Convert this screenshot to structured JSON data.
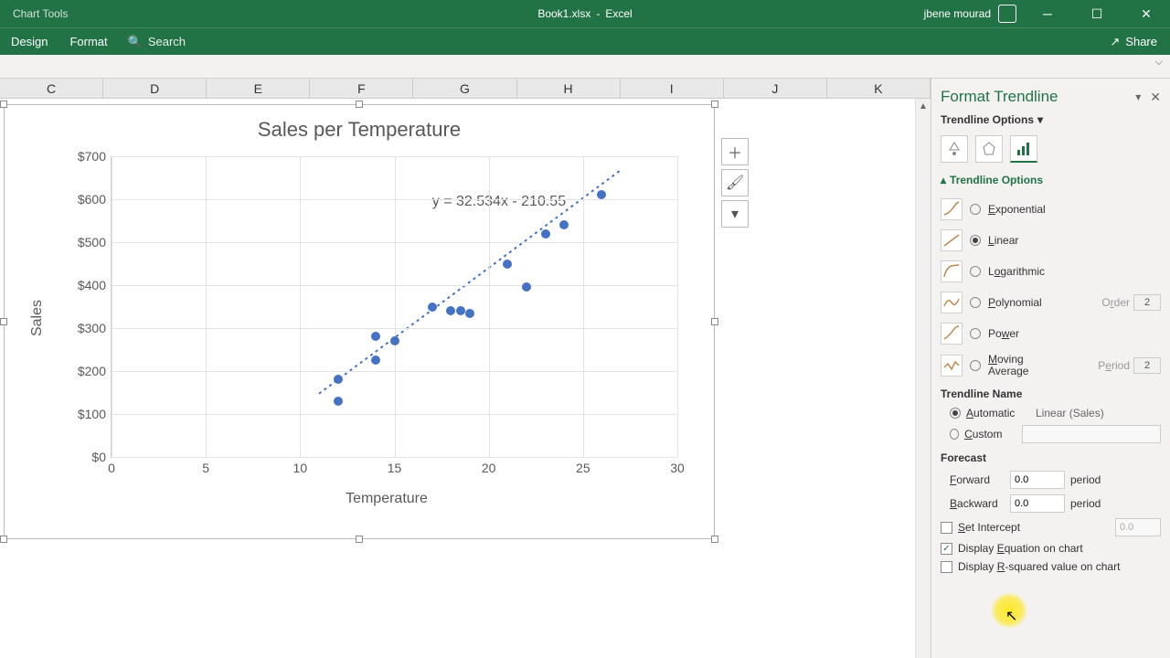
{
  "titlebar": {
    "chart_tools": "Chart Tools",
    "filename": "Book1.xlsx",
    "appname": "Excel",
    "user": "jbene mourad"
  },
  "tabs": {
    "design": "Design",
    "format": "Format",
    "search": "Search",
    "share": "Share"
  },
  "columns": [
    "C",
    "D",
    "E",
    "F",
    "G",
    "H",
    "I",
    "J",
    "K"
  ],
  "chart_title": "Sales per Temperature",
  "chart_ylabel": "Sales",
  "chart_xlabel": "Temperature",
  "chart_equation": "y = 32.534x - 210.55",
  "chart_data": {
    "type": "scatter",
    "title": "Sales per Temperature",
    "xlabel": "Temperature",
    "ylabel": "Sales",
    "xlim": [
      0,
      30
    ],
    "ylim": [
      0,
      700
    ],
    "xticks": [
      0,
      5,
      10,
      15,
      20,
      25,
      30
    ],
    "yticks": [
      0,
      100,
      200,
      300,
      400,
      500,
      600,
      700
    ],
    "ytick_labels": [
      "$0",
      "$100",
      "$200",
      "$300",
      "$400",
      "$500",
      "$600",
      "$700"
    ],
    "points": [
      {
        "x": 12,
        "y": 180
      },
      {
        "x": 12,
        "y": 130
      },
      {
        "x": 14,
        "y": 225
      },
      {
        "x": 14,
        "y": 280
      },
      {
        "x": 15,
        "y": 270
      },
      {
        "x": 17,
        "y": 350
      },
      {
        "x": 18,
        "y": 340
      },
      {
        "x": 18.5,
        "y": 340
      },
      {
        "x": 19,
        "y": 335
      },
      {
        "x": 21,
        "y": 450
      },
      {
        "x": 22,
        "y": 395
      },
      {
        "x": 23,
        "y": 520
      },
      {
        "x": 24,
        "y": 540
      },
      {
        "x": 26,
        "y": 610
      }
    ],
    "trendline": {
      "type": "linear",
      "slope": 32.534,
      "intercept": -210.55,
      "equation": "y = 32.534x - 210.55"
    }
  },
  "pane": {
    "title": "Format Trendline",
    "sub": "Trendline Options",
    "section": "Trendline Options",
    "opts": {
      "exponential": "Exponential",
      "linear": "Linear",
      "logarithmic": "Logarithmic",
      "polynomial": "Polynomial",
      "power": "Power",
      "moving": "Moving Average",
      "order_label": "Order",
      "order_val": "2",
      "period_label": "Period",
      "period_val": "2"
    },
    "name": {
      "head": "Trendline Name",
      "automatic": "Automatic",
      "custom": "Custom",
      "auto_val": "Linear (Sales)"
    },
    "forecast": {
      "head": "Forecast",
      "forward": "Forward",
      "backward": "Backward",
      "fval": "0.0",
      "bval": "0.0",
      "period": "period"
    },
    "checks": {
      "set_intercept": "Set Intercept",
      "intercept_val": "0.0",
      "disp_eq": "Display Equation on chart",
      "disp_r2": "Display R-squared value on chart"
    }
  }
}
